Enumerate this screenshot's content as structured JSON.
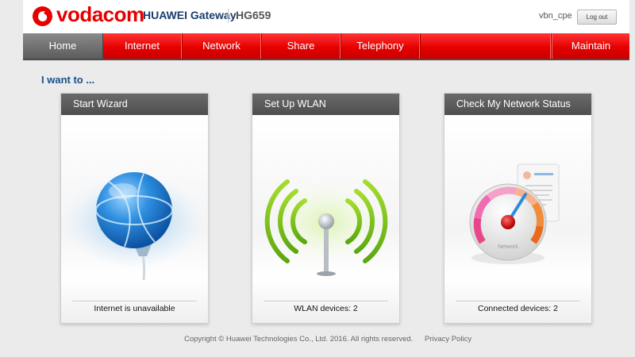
{
  "header": {
    "brand": "vodacom",
    "product": "HUAWEI Gateway",
    "model": "HG659",
    "user": "vbn_cpe",
    "logout_label": "Log out"
  },
  "nav": {
    "items": [
      "Home",
      "Internet",
      "Network",
      "Share",
      "Telephony",
      "Maintain"
    ],
    "active": "Home"
  },
  "main": {
    "title": "I want to ...",
    "cards": [
      {
        "title": "Start Wizard",
        "status": "Internet is unavailable",
        "icon": "globe-icon"
      },
      {
        "title": "Set Up WLAN",
        "status": "WLAN devices: 2",
        "icon": "wlan-antenna-icon"
      },
      {
        "title": "Check My Network Status",
        "status": "Connected devices: 2",
        "icon": "network-gauge-icon",
        "gauge_label": "Network"
      }
    ]
  },
  "footer": {
    "copyright": "Copyright © Huawei Technologies Co., Ltd. 2016. All rights reserved.",
    "privacy": "Privacy Policy"
  },
  "colors": {
    "brand_red": "#e60000",
    "nav_active": "#6a6a6a",
    "title_blue": "#1b4f8a"
  }
}
